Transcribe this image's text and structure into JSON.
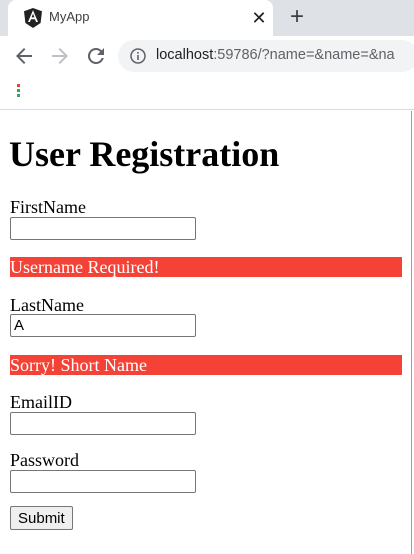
{
  "browser": {
    "tab_title": "MyApp",
    "tab_close_glyph": "✕",
    "new_tab_glyph": "+",
    "url_host": "localhost",
    "url_rest": ":59786/?name=&name=&na",
    "favicon": "angular-icon",
    "brand_color": "#c3002f"
  },
  "form": {
    "title": "User Registration",
    "firstname_label": "FirstName",
    "firstname_value": "",
    "firstname_error": "Username Required!",
    "lastname_label": "LastName",
    "lastname_value": "A",
    "lastname_error": "Sorry! Short Name",
    "email_label": "EmailID",
    "email_value": "",
    "password_label": "Password",
    "password_value": "",
    "submit_label": "Submit",
    "error_color": "#f44336"
  }
}
